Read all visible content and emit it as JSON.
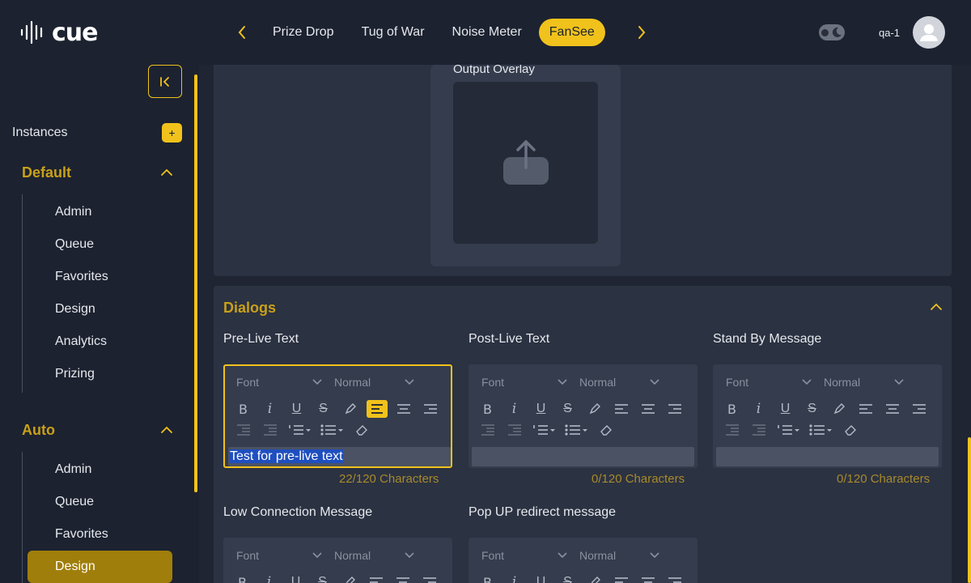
{
  "brand": {
    "logo_text": "cue"
  },
  "nav": {
    "items": [
      "Prize Drop",
      "Tug of War",
      "Noise Meter",
      "FanSee"
    ],
    "active": "FanSee"
  },
  "user": {
    "name": "qa-1"
  },
  "sidebar": {
    "instances_label": "Instances",
    "add_label": "+",
    "groups": [
      {
        "title": "Default",
        "items": [
          "Admin",
          "Queue",
          "Favorites",
          "Design",
          "Analytics",
          "Prizing"
        ]
      },
      {
        "title": "Auto",
        "items": [
          "Admin",
          "Queue",
          "Favorites",
          "Design"
        ]
      }
    ],
    "active_item": "Design"
  },
  "overlay": {
    "label": "Output Overlay"
  },
  "dialogs": {
    "title": "Dialogs",
    "editors": [
      {
        "label": "Pre-Live Text",
        "font": "Font",
        "size": "Normal",
        "content": "Test for pre-live text",
        "counter": "22/120 Characters"
      },
      {
        "label": "Post-Live Text",
        "font": "Font",
        "size": "Normal",
        "content": "",
        "counter": "0/120 Characters"
      },
      {
        "label": "Stand By Message",
        "font": "Font",
        "size": "Normal",
        "content": "",
        "counter": "0/120 Characters"
      },
      {
        "label": "Low Connection Message",
        "font": "Font",
        "size": "Normal"
      },
      {
        "label": "Pop UP redirect message",
        "font": "Font",
        "size": "Normal"
      }
    ]
  },
  "colors": {
    "accent": "#f1c21b",
    "background": "#1f2532",
    "panel": "#2b3242",
    "selection": "#1f4fbf"
  }
}
